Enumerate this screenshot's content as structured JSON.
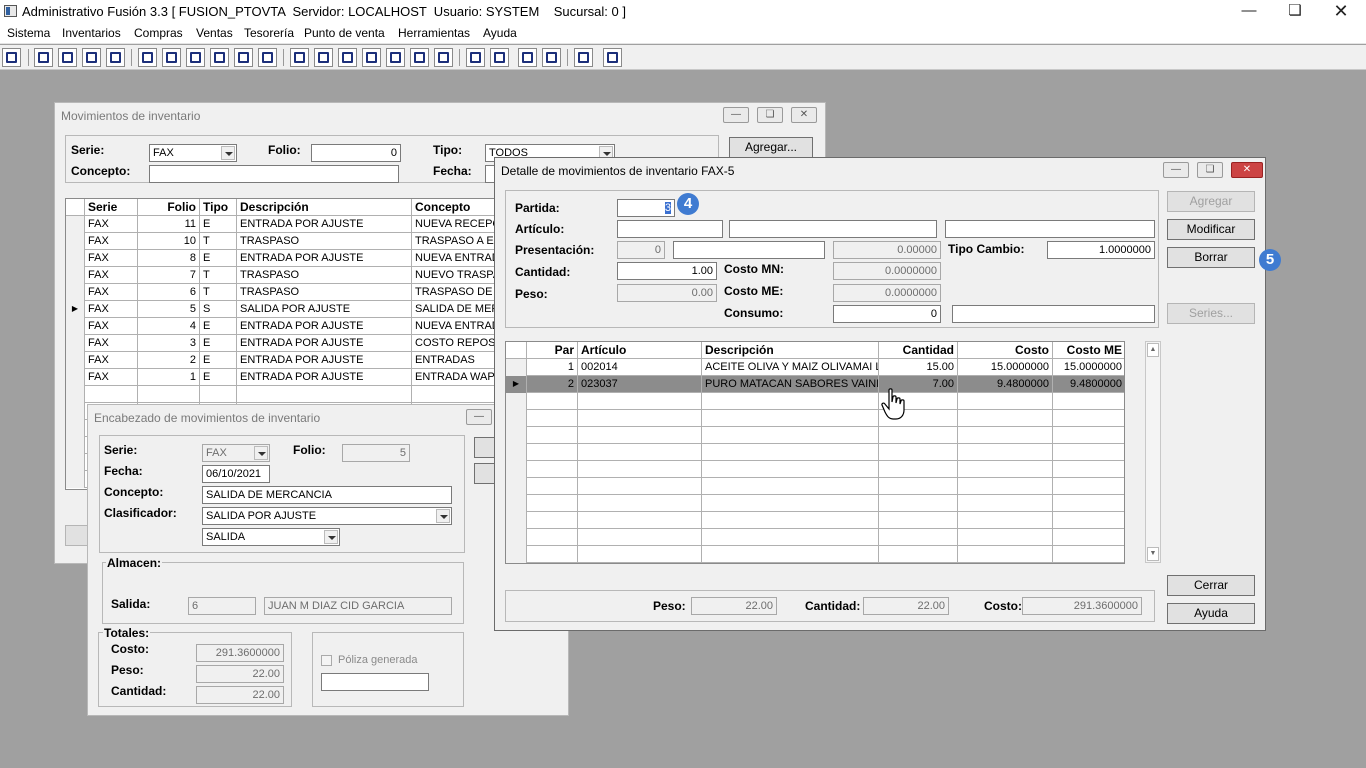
{
  "app": {
    "title": "Administrativo Fusión 3.3 [ FUSION_PTOVTA  Servidor: LOCALHOST  Usuario: SYSTEM    Sucursal: 0 ]"
  },
  "menu": [
    "Sistema",
    "Inventarios",
    "Compras",
    "Ventas",
    "Tesorería",
    "Punto de venta",
    "Herramientas",
    "Ayuda"
  ],
  "movimientos": {
    "title": "Movimientos de inventario",
    "serie_label": "Serie:",
    "serie_value": "FAX",
    "folio_label": "Folio:",
    "folio_value": "0",
    "tipo_label": "Tipo:",
    "tipo_value": "TODOS",
    "concepto_label": "Concepto:",
    "fecha_label": "Fecha:",
    "agregar": "Agregar...",
    "headers": [
      "Serie",
      "Folio",
      "Tipo",
      "Descripción",
      "Concepto"
    ],
    "rows": [
      {
        "serie": "FAX",
        "folio": "11",
        "tipo": "E",
        "descripcion": "ENTRADA POR AJUSTE",
        "concepto": "NUEVA RECEPCIÓN"
      },
      {
        "serie": "FAX",
        "folio": "10",
        "tipo": "T",
        "descripcion": "TRASPASO",
        "concepto": "TRASPASO A ECI"
      },
      {
        "serie": "FAX",
        "folio": "8",
        "tipo": "E",
        "descripcion": "ENTRADA POR AJUSTE",
        "concepto": "NUEVA ENTRADA"
      },
      {
        "serie": "FAX",
        "folio": "7",
        "tipo": "T",
        "descripcion": "TRASPASO",
        "concepto": "NUEVO TRASPASO"
      },
      {
        "serie": "FAX",
        "folio": "6",
        "tipo": "T",
        "descripcion": "TRASPASO",
        "concepto": "TRASPASO DE MERC"
      },
      {
        "serie": "FAX",
        "folio": "5",
        "tipo": "S",
        "descripcion": "SALIDA POR AJUSTE",
        "concepto": "SALIDA DE MERC"
      },
      {
        "serie": "FAX",
        "folio": "4",
        "tipo": "E",
        "descripcion": "ENTRADA POR AJUSTE",
        "concepto": "NUEVA ENTRADA"
      },
      {
        "serie": "FAX",
        "folio": "3",
        "tipo": "E",
        "descripcion": "ENTRADA POR AJUSTE",
        "concepto": "COSTO REPOSICIÓN"
      },
      {
        "serie": "FAX",
        "folio": "2",
        "tipo": "E",
        "descripcion": "ENTRADA POR AJUSTE",
        "concepto": "ENTRADAS"
      },
      {
        "serie": "FAX",
        "folio": "1",
        "tipo": "E",
        "descripcion": "ENTRADA POR AJUSTE",
        "concepto": "ENTRADA WAPP"
      }
    ],
    "selected_row": 5
  },
  "encabezado": {
    "title": "Encabezado de movimientos de inventario",
    "serie_label": "Serie:",
    "serie_value": "FAX",
    "folio_label": "Folio:",
    "folio_value": "5",
    "fecha_label": "Fecha:",
    "fecha_value": "06/10/2021",
    "concepto_label": "Concepto:",
    "concepto_value": "SALIDA DE MERCANCIA",
    "clasificador_label": "Clasificador:",
    "clasificador_value": "SALIDA POR AJUSTE",
    "clasificador2_value": "SALIDA",
    "almacen_label": "Almacen:",
    "salida_label": "Salida:",
    "salida_num": "6",
    "salida_name": "JUAN M DIAZ CID GARCIA",
    "totales_label": "Totales:",
    "costo_label": "Costo:",
    "costo_value": "291.3600000",
    "peso_label": "Peso:",
    "peso_value": "22.00",
    "cantidad_label": "Cantidad:",
    "cantidad_value": "22.00",
    "poliza_label": "Póliza generada"
  },
  "detalle": {
    "title": "Detalle de movimientos de inventario FAX-5",
    "partida_label": "Partida:",
    "partida_value": "3",
    "articulo_label": "Artículo:",
    "presentacion_label": "Presentación:",
    "presentacion_num": "0",
    "presentacion_val": "0.00000",
    "tipo_cambio_label": "Tipo Cambio:",
    "tipo_cambio_value": "1.0000000",
    "cantidad_label": "Cantidad:",
    "cantidad_value": "1.00",
    "costo_mn_label": "Costo MN:",
    "costo_mn_value": "0.0000000",
    "peso_label": "Peso:",
    "peso_value": "0.00",
    "costo_me_label": "Costo ME:",
    "costo_me_value": "0.0000000",
    "consumo_label": "Consumo:",
    "consumo_value": "0",
    "btn_agregar": "Agregar",
    "btn_modificar": "Modificar",
    "btn_borrar": "Borrar",
    "btn_series": "Series...",
    "btn_cerrar": "Cerrar",
    "btn_ayuda": "Ayuda",
    "headers": [
      "Par",
      "Artículo",
      "Descripción",
      "Cantidad",
      "Costo",
      "Costo ME"
    ],
    "rows": [
      {
        "par": "1",
        "articulo": "002014",
        "descripcion": "ACEITE OLIVA Y MAIZ OLIVAMAI LT",
        "cantidad": "15.00",
        "costo": "15.0000000",
        "costo_me": "15.0000000"
      },
      {
        "par": "2",
        "articulo": "023037",
        "descripcion": "PURO MATACAN SABORES VAINILLA",
        "cantidad": "7.00",
        "costo": "9.4800000",
        "costo_me": "9.4800000"
      }
    ],
    "footer_peso_label": "Peso:",
    "footer_peso": "22.00",
    "footer_cantidad_label": "Cantidad:",
    "footer_cantidad": "22.00",
    "footer_costo_label": "Costo:",
    "footer_costo": "291.3600000"
  },
  "badges": {
    "b4": "4",
    "b5": "5"
  },
  "colors": {
    "badge": "#3f7bd1",
    "selected_row": "#8c8c8c",
    "desktop": "#a0a0a0"
  }
}
